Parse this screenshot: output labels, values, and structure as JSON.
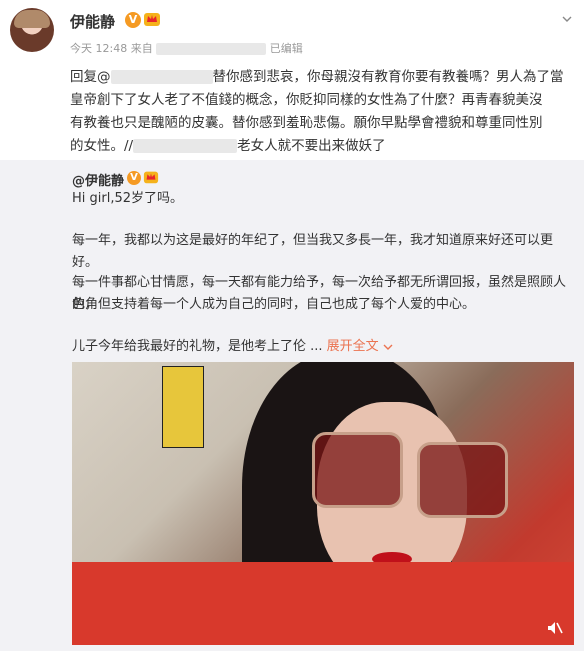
{
  "post": {
    "username": "伊能静",
    "time": "今天 12:48",
    "from_prefix": "来自",
    "edited": "已编辑",
    "reply_prefix": "回复@",
    "reply_line1": "替你感到悲哀，你母親沒有教育你要有教養嗎？男人為了當",
    "reply_line2": "皇帝創下了女人老了不值錢的概念，你貶抑同樣的女性為了什麼？再青春貌美沒",
    "reply_line3": "有教養也只是醜陋的皮囊。替你感到羞恥悲傷。願你早點學會禮貌和尊重同性別",
    "reply_line4_a": "的女性。//",
    "reply_line4_b": "老女人就不要出来做妖了"
  },
  "retweet": {
    "username": "@伊能静",
    "line1": "Hi girl,52岁了吗。",
    "line2": "每一年，我都以为这是最好的年纪了，但当我又多長一年，我才知道原来好还可以更好。",
    "line3": "每一件事都心甘情愿，每一天都有能力给予，每一次给予都无所谓回报，虽然是照顾人的角",
    "line4": "色，但支持着每一个人成为自己的同时，自己也成了每个人爱的中心。",
    "line5": "儿子今年给我最好的礼物，是他考上了伦 ...",
    "expand": "展开全文"
  },
  "icons": {
    "verified": "verified-v-icon",
    "member": "member-crown-icon",
    "menu": "chevron-down-icon",
    "mute": "mute-icon"
  },
  "colors": {
    "accent": "#eb7350",
    "badge": "#f59a23",
    "retweet_bg": "#f2f2f5"
  }
}
